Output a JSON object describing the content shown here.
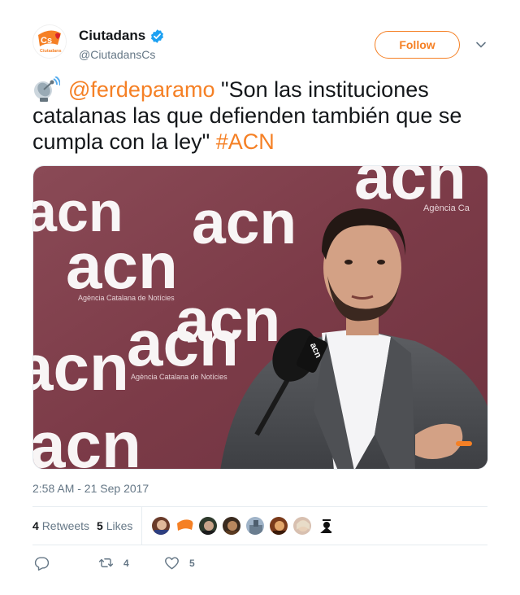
{
  "account": {
    "display_name": "Ciutadans",
    "handle": "@CiutadansCs",
    "avatar_text": "Cs",
    "avatar_subtext": "Ciutadans",
    "brand_color": "#f58025",
    "verified": true
  },
  "follow_label": "Follow",
  "tweet": {
    "mention": "@ferdeparamo",
    "text": " \"Son las instituciones catalanas las que defienden también que se cumpla con la ley\" ",
    "hashtag": "#ACN",
    "emoji_icon": "satellite-dish-icon"
  },
  "media": {
    "backdrop_logo": "acn",
    "backdrop_subtitle": "Agència Catalana de Notícies",
    "corner_subtitle": "Agència Ca"
  },
  "timestamp": "2:58 AM - 21 Sep 2017",
  "stats": {
    "retweets_count": "4",
    "retweets_label": "Retweets",
    "likes_count": "5",
    "likes_label": "Likes"
  },
  "actions": {
    "reply_count": "",
    "retweet_count": "4",
    "like_count": "5"
  }
}
